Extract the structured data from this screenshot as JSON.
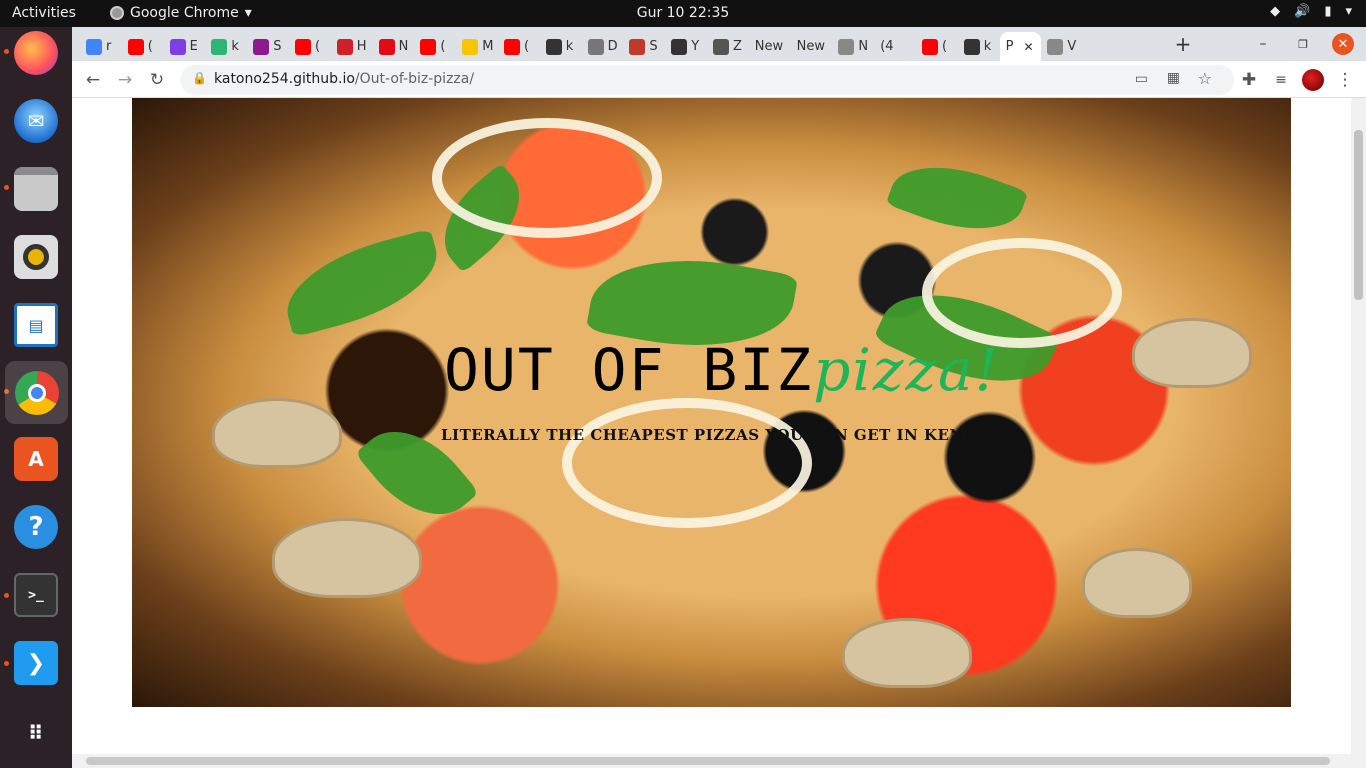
{
  "topbar": {
    "activities": "Activities",
    "app_name": "Google Chrome",
    "clock": "Gur 10  22:35"
  },
  "dock": {
    "items": [
      "firefox-icon",
      "thunderbird-icon",
      "files-icon",
      "rhythmbox-icon",
      "libreoffice-impress-icon",
      "chrome-icon",
      "app-center-icon",
      "help-icon",
      "terminal-icon",
      "vscode-icon",
      "show-apps-icon"
    ]
  },
  "tabs": [
    {
      "label": "r",
      "fav": "#4285f4"
    },
    {
      "label": "(",
      "fav": "#ff0000"
    },
    {
      "label": "E",
      "fav": "#7b3fe4"
    },
    {
      "label": "k",
      "fav": "#2bb673"
    },
    {
      "label": "S",
      "fav": "#8e1b8e"
    },
    {
      "label": "(",
      "fav": "#ff0000"
    },
    {
      "label": "H",
      "fav": "#d0202a"
    },
    {
      "label": "N",
      "fav": "#e50914"
    },
    {
      "label": "(",
      "fav": "#ff0000"
    },
    {
      "label": "M",
      "fav": "#f7c600"
    },
    {
      "label": "(",
      "fav": "#ff0000"
    },
    {
      "label": "k",
      "fav": "#333333"
    },
    {
      "label": "D",
      "fav": "#777777"
    },
    {
      "label": "S",
      "fav": "#c0392b"
    },
    {
      "label": "Y",
      "fav": "#333333"
    },
    {
      "label": "Z",
      "fav": "#555555"
    },
    {
      "label": "New",
      "fav": ""
    },
    {
      "label": "New",
      "fav": ""
    },
    {
      "label": "N",
      "fav": "#888888"
    },
    {
      "label": "(4",
      "fav": ""
    },
    {
      "label": "(",
      "fav": "#ff0000"
    },
    {
      "label": "k",
      "fav": "#333333"
    },
    {
      "label": "P",
      "fav": ""
    },
    {
      "label": "V",
      "fav": "#888888"
    }
  ],
  "active_tab_index": 22,
  "address": {
    "host": "katono254.github.io",
    "path": "/Out-of-biz-pizza/"
  },
  "page": {
    "title_part1": "OUT OF BIZ",
    "title_part2": "pizza!",
    "subtitle": "LITERALLY THE CHEAPEST PIZZAS YOU CAN GET IN KENYA"
  },
  "colors": {
    "title_green": "#1cb55a",
    "chrome_tabstrip": "#dee1e6"
  }
}
